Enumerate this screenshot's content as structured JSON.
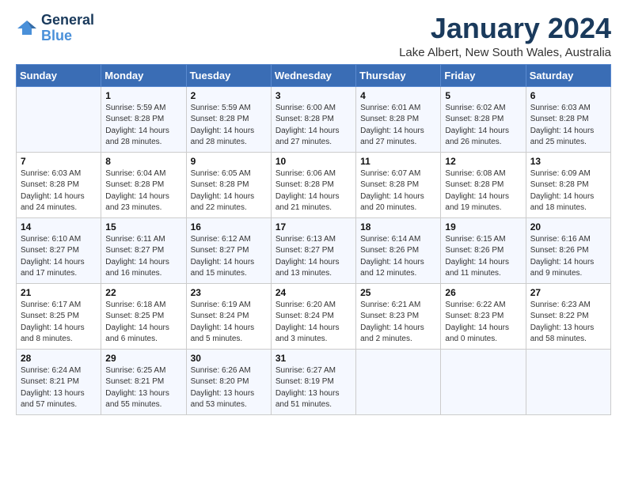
{
  "header": {
    "logo_line1": "General",
    "logo_line2": "Blue",
    "month": "January 2024",
    "location": "Lake Albert, New South Wales, Australia"
  },
  "weekdays": [
    "Sunday",
    "Monday",
    "Tuesday",
    "Wednesday",
    "Thursday",
    "Friday",
    "Saturday"
  ],
  "weeks": [
    [
      {
        "day": "",
        "info": ""
      },
      {
        "day": "1",
        "info": "Sunrise: 5:59 AM\nSunset: 8:28 PM\nDaylight: 14 hours\nand 28 minutes."
      },
      {
        "day": "2",
        "info": "Sunrise: 5:59 AM\nSunset: 8:28 PM\nDaylight: 14 hours\nand 28 minutes."
      },
      {
        "day": "3",
        "info": "Sunrise: 6:00 AM\nSunset: 8:28 PM\nDaylight: 14 hours\nand 27 minutes."
      },
      {
        "day": "4",
        "info": "Sunrise: 6:01 AM\nSunset: 8:28 PM\nDaylight: 14 hours\nand 27 minutes."
      },
      {
        "day": "5",
        "info": "Sunrise: 6:02 AM\nSunset: 8:28 PM\nDaylight: 14 hours\nand 26 minutes."
      },
      {
        "day": "6",
        "info": "Sunrise: 6:03 AM\nSunset: 8:28 PM\nDaylight: 14 hours\nand 25 minutes."
      }
    ],
    [
      {
        "day": "7",
        "info": "Sunrise: 6:03 AM\nSunset: 8:28 PM\nDaylight: 14 hours\nand 24 minutes."
      },
      {
        "day": "8",
        "info": "Sunrise: 6:04 AM\nSunset: 8:28 PM\nDaylight: 14 hours\nand 23 minutes."
      },
      {
        "day": "9",
        "info": "Sunrise: 6:05 AM\nSunset: 8:28 PM\nDaylight: 14 hours\nand 22 minutes."
      },
      {
        "day": "10",
        "info": "Sunrise: 6:06 AM\nSunset: 8:28 PM\nDaylight: 14 hours\nand 21 minutes."
      },
      {
        "day": "11",
        "info": "Sunrise: 6:07 AM\nSunset: 8:28 PM\nDaylight: 14 hours\nand 20 minutes."
      },
      {
        "day": "12",
        "info": "Sunrise: 6:08 AM\nSunset: 8:28 PM\nDaylight: 14 hours\nand 19 minutes."
      },
      {
        "day": "13",
        "info": "Sunrise: 6:09 AM\nSunset: 8:28 PM\nDaylight: 14 hours\nand 18 minutes."
      }
    ],
    [
      {
        "day": "14",
        "info": "Sunrise: 6:10 AM\nSunset: 8:27 PM\nDaylight: 14 hours\nand 17 minutes."
      },
      {
        "day": "15",
        "info": "Sunrise: 6:11 AM\nSunset: 8:27 PM\nDaylight: 14 hours\nand 16 minutes."
      },
      {
        "day": "16",
        "info": "Sunrise: 6:12 AM\nSunset: 8:27 PM\nDaylight: 14 hours\nand 15 minutes."
      },
      {
        "day": "17",
        "info": "Sunrise: 6:13 AM\nSunset: 8:27 PM\nDaylight: 14 hours\nand 13 minutes."
      },
      {
        "day": "18",
        "info": "Sunrise: 6:14 AM\nSunset: 8:26 PM\nDaylight: 14 hours\nand 12 minutes."
      },
      {
        "day": "19",
        "info": "Sunrise: 6:15 AM\nSunset: 8:26 PM\nDaylight: 14 hours\nand 11 minutes."
      },
      {
        "day": "20",
        "info": "Sunrise: 6:16 AM\nSunset: 8:26 PM\nDaylight: 14 hours\nand 9 minutes."
      }
    ],
    [
      {
        "day": "21",
        "info": "Sunrise: 6:17 AM\nSunset: 8:25 PM\nDaylight: 14 hours\nand 8 minutes."
      },
      {
        "day": "22",
        "info": "Sunrise: 6:18 AM\nSunset: 8:25 PM\nDaylight: 14 hours\nand 6 minutes."
      },
      {
        "day": "23",
        "info": "Sunrise: 6:19 AM\nSunset: 8:24 PM\nDaylight: 14 hours\nand 5 minutes."
      },
      {
        "day": "24",
        "info": "Sunrise: 6:20 AM\nSunset: 8:24 PM\nDaylight: 14 hours\nand 3 minutes."
      },
      {
        "day": "25",
        "info": "Sunrise: 6:21 AM\nSunset: 8:23 PM\nDaylight: 14 hours\nand 2 minutes."
      },
      {
        "day": "26",
        "info": "Sunrise: 6:22 AM\nSunset: 8:23 PM\nDaylight: 14 hours\nand 0 minutes."
      },
      {
        "day": "27",
        "info": "Sunrise: 6:23 AM\nSunset: 8:22 PM\nDaylight: 13 hours\nand 58 minutes."
      }
    ],
    [
      {
        "day": "28",
        "info": "Sunrise: 6:24 AM\nSunset: 8:21 PM\nDaylight: 13 hours\nand 57 minutes."
      },
      {
        "day": "29",
        "info": "Sunrise: 6:25 AM\nSunset: 8:21 PM\nDaylight: 13 hours\nand 55 minutes."
      },
      {
        "day": "30",
        "info": "Sunrise: 6:26 AM\nSunset: 8:20 PM\nDaylight: 13 hours\nand 53 minutes."
      },
      {
        "day": "31",
        "info": "Sunrise: 6:27 AM\nSunset: 8:19 PM\nDaylight: 13 hours\nand 51 minutes."
      },
      {
        "day": "",
        "info": ""
      },
      {
        "day": "",
        "info": ""
      },
      {
        "day": "",
        "info": ""
      }
    ]
  ]
}
